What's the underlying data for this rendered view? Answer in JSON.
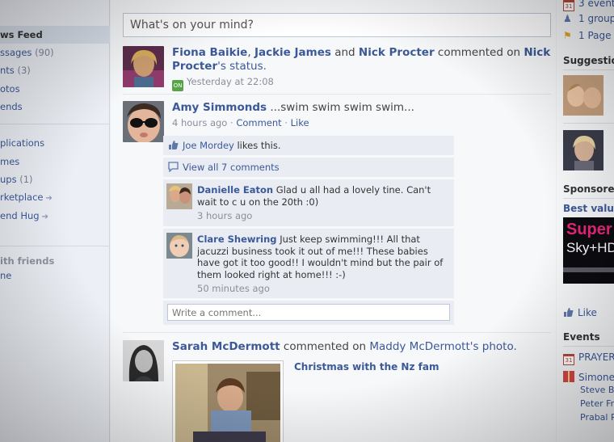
{
  "left_nav": {
    "news_feed": "ws Feed",
    "messages": "ssages",
    "messages_count": "(90)",
    "events": "nts",
    "events_count": "(3)",
    "photos": "otos",
    "friends": "ends",
    "applications": "plications",
    "games": "mes",
    "groups": "ups",
    "groups_count": "(1)",
    "marketplace": "rketplace",
    "send_hug": "end Hug",
    "chat_heading": "ith friends",
    "chat_status": "ne"
  },
  "composer": {
    "placeholder": "What's on your mind?"
  },
  "feed": {
    "story1": {
      "actor1": "Fiona Baikie",
      "sep": ", ",
      "actor2": "Jackie James",
      "and": " and ",
      "actor3": "Nick Procter",
      "verb": " commented on ",
      "target": "Nick Procter",
      "target_suffix": "'s status.",
      "mobile_badge": "ON",
      "time": "Yesterday at 22:08"
    },
    "story2": {
      "actor": "Amy Simmonds",
      "status": " ...swim swim swim swim...",
      "time": "4 hours ago",
      "dot1": " · ",
      "comment_link": "Comment",
      "dot2": " · ",
      "like_link": "Like",
      "likes_user": "Joe Mordey",
      "likes_text": " likes this.",
      "view_all": "View all 7 comments",
      "comments": [
        {
          "author": "Danielle Eaton",
          "text": " Glad u all had a lovely tine. Can't wait to c u on the 20th :0)",
          "time": "3 hours ago"
        },
        {
          "author": "Clare Shewring",
          "text": " Just keep swimming!!! All that jacuzzi business took it out of me!!! These babies have got it too good!! I wouldn't mind but the pair of them looked right at home!!! :-)",
          "time": "50 minutes ago"
        }
      ],
      "comment_placeholder": "Write a comment..."
    },
    "story3": {
      "actor": "Sarah McDermott",
      "verb": " commented on ",
      "target": "Maddy McDermott",
      "target_suffix": "'s photo.",
      "album": "Christmas with the Nz fam"
    }
  },
  "right_col": {
    "events_line": "3 event",
    "groups_line": "1 group",
    "pages_line": "1 Page s",
    "suggestions_heading": "Suggestion",
    "sponsored_heading": "Sponsored",
    "ad_title": "Best value",
    "ad_text1": "Super",
    "ad_text2": "Sky+HD",
    "like_label": "Like",
    "events_heading": "Events",
    "event1": "PRAYER",
    "birthday1": "Simone",
    "birthday2": "Steve Bl",
    "birthday3": "Peter Fr",
    "birthday4": "Prabal R"
  },
  "colors": {
    "link": "#3b5998",
    "comment_bg": "#e9ecf3",
    "sidebar_bg": "#eceff5"
  }
}
